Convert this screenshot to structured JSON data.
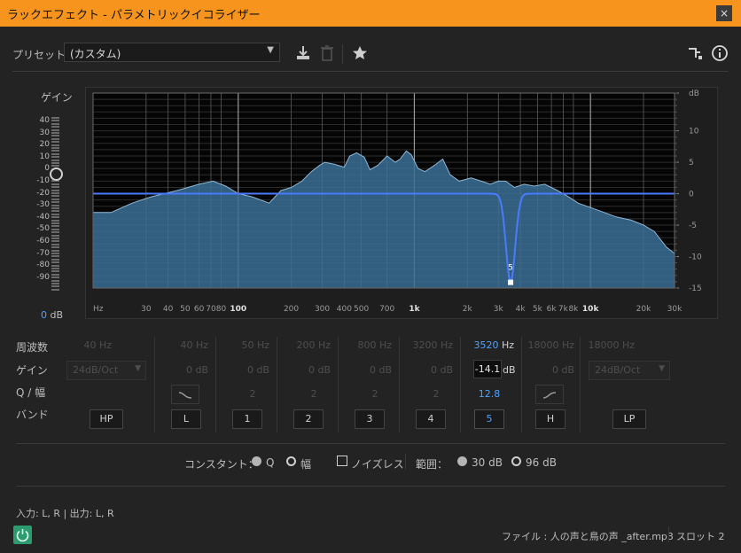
{
  "window": {
    "title": "ラックエフェクト - パラメトリックイコライザー",
    "close": "×"
  },
  "preset": {
    "label": "プリセット：",
    "value": "(カスタム)"
  },
  "gain_panel": {
    "title": "ゲイン",
    "scale": [
      "40",
      "30",
      "20",
      "10",
      "0",
      "-10",
      "-20",
      "-30",
      "-40",
      "-50",
      "-60",
      "-70",
      "-80",
      "-90"
    ],
    "value": "0",
    "unit": "dB"
  },
  "graph": {
    "freq_ticks": [
      {
        "label": "Hz",
        "f": 15
      },
      {
        "label": "30",
        "f": 30
      },
      {
        "label": "40",
        "f": 40
      },
      {
        "label": "50",
        "f": 50
      },
      {
        "label": "60",
        "f": 60
      },
      {
        "label": "70",
        "f": 70
      },
      {
        "label": "80",
        "f": 80
      },
      {
        "label": "100",
        "f": 100,
        "bold": true
      },
      {
        "label": "200",
        "f": 200
      },
      {
        "label": "300",
        "f": 300
      },
      {
        "label": "400",
        "f": 400
      },
      {
        "label": "500",
        "f": 500
      },
      {
        "label": "700",
        "f": 700
      },
      {
        "label": "1k",
        "f": 1000,
        "bold": true
      },
      {
        "label": "2k",
        "f": 2000
      },
      {
        "label": "3k",
        "f": 3000
      },
      {
        "label": "4k",
        "f": 4000
      },
      {
        "label": "5k",
        "f": 5000
      },
      {
        "label": "6k",
        "f": 6000
      },
      {
        "label": "7k",
        "f": 7000
      },
      {
        "label": "8k",
        "f": 8000
      },
      {
        "label": "10k",
        "f": 10000,
        "bold": true
      },
      {
        "label": "20k",
        "f": 20000
      },
      {
        "label": "30k",
        "f": 30000
      }
    ],
    "db_ticks": [
      {
        "label": "dB",
        "v": 16
      },
      {
        "label": "10",
        "v": 10
      },
      {
        "label": "5",
        "v": 5
      },
      {
        "label": "0",
        "v": 0
      },
      {
        "label": "-5",
        "v": -5
      },
      {
        "label": "-10",
        "v": -10
      },
      {
        "label": "-15",
        "v": -15
      }
    ],
    "db_range": [
      -15,
      16
    ],
    "freq_range": [
      15,
      30000
    ],
    "band_marker": {
      "label": "5",
      "freq": 3520,
      "gain": -14.1
    },
    "spectrum": [
      [
        15,
        -3
      ],
      [
        19,
        -3
      ],
      [
        25,
        -1.5
      ],
      [
        32,
        -0.5
      ],
      [
        45,
        0.5
      ],
      [
        60,
        1.5
      ],
      [
        72,
        2
      ],
      [
        85,
        1.2
      ],
      [
        100,
        0
      ],
      [
        120,
        -0.5
      ],
      [
        150,
        -1.5
      ],
      [
        175,
        0.5
      ],
      [
        200,
        1
      ],
      [
        230,
        2
      ],
      [
        260,
        3.5
      ],
      [
        290,
        4.5
      ],
      [
        310,
        5
      ],
      [
        350,
        4.7
      ],
      [
        400,
        4.2
      ],
      [
        430,
        6
      ],
      [
        470,
        6.5
      ],
      [
        520,
        5.8
      ],
      [
        560,
        3.8
      ],
      [
        620,
        4.5
      ],
      [
        700,
        6
      ],
      [
        780,
        5
      ],
      [
        830,
        5.5
      ],
      [
        900,
        6.8
      ],
      [
        960,
        6.2
      ],
      [
        1050,
        4
      ],
      [
        1150,
        3.5
      ],
      [
        1300,
        4.5
      ],
      [
        1450,
        5.5
      ],
      [
        1600,
        3
      ],
      [
        1800,
        2
      ],
      [
        2100,
        2.5
      ],
      [
        2400,
        2
      ],
      [
        2700,
        1.5
      ],
      [
        3000,
        2
      ],
      [
        3300,
        2
      ],
      [
        3700,
        1
      ],
      [
        4200,
        1.5
      ],
      [
        4800,
        1.2
      ],
      [
        5500,
        1.5
      ],
      [
        6500,
        0.5
      ],
      [
        7500,
        -0.5
      ],
      [
        8500,
        -1.5
      ],
      [
        10000,
        -2.2
      ],
      [
        12000,
        -3
      ],
      [
        14000,
        -3.7
      ],
      [
        17000,
        -4.2
      ],
      [
        20000,
        -5
      ],
      [
        23000,
        -6
      ],
      [
        27000,
        -8.5
      ],
      [
        30000,
        -9.5
      ]
    ],
    "colors": {
      "fill": "#3b6f95",
      "stroke": "#8fb8d6",
      "curve": "#4a7bff",
      "grid": "#5d5d5d",
      "grid_bold": "#9a9a9a"
    }
  },
  "bands": {
    "row_labels": {
      "freq": "周波数",
      "gain": "ゲイン",
      "q": "Q / 幅",
      "band": "バンド"
    },
    "hp": {
      "freq": "40 Hz",
      "slope": "24dB/Oct",
      "label": "HP"
    },
    "l": {
      "freq": "40 Hz",
      "gain": "0 dB",
      "label": "L"
    },
    "b1": {
      "freq": "50 Hz",
      "gain": "0 dB",
      "q": "2",
      "label": "1"
    },
    "b2": {
      "freq": "200 Hz",
      "gain": "0 dB",
      "q": "2",
      "label": "2"
    },
    "b3": {
      "freq": "800 Hz",
      "gain": "0 dB",
      "q": "2",
      "label": "3"
    },
    "b4": {
      "freq": "3200 Hz",
      "gain": "0 dB",
      "q": "2",
      "label": "4"
    },
    "b5": {
      "freq_value": "3520",
      "freq_unit": "Hz",
      "gain_value": "-14.1",
      "gain_unit": "dB",
      "q": "12.8",
      "label": "5"
    },
    "h": {
      "freq": "18000 Hz",
      "gain": "0 dB",
      "label": "H"
    },
    "lp": {
      "freq": "18000 Hz",
      "slope": "24dB/Oct",
      "label": "LP"
    }
  },
  "options": {
    "constant_label": "コンスタント：",
    "q_label": "Q",
    "width_label": "幅",
    "noise_label": "ノイズレス",
    "range_label": "範囲：",
    "range_30": "30 dB",
    "range_96": "96 dB"
  },
  "footer": {
    "io": "入力: L, R | 出力: L, R",
    "file": "ファイル : 人の声と鳥の声 _after.mp3",
    "slot": "スロット 2"
  }
}
